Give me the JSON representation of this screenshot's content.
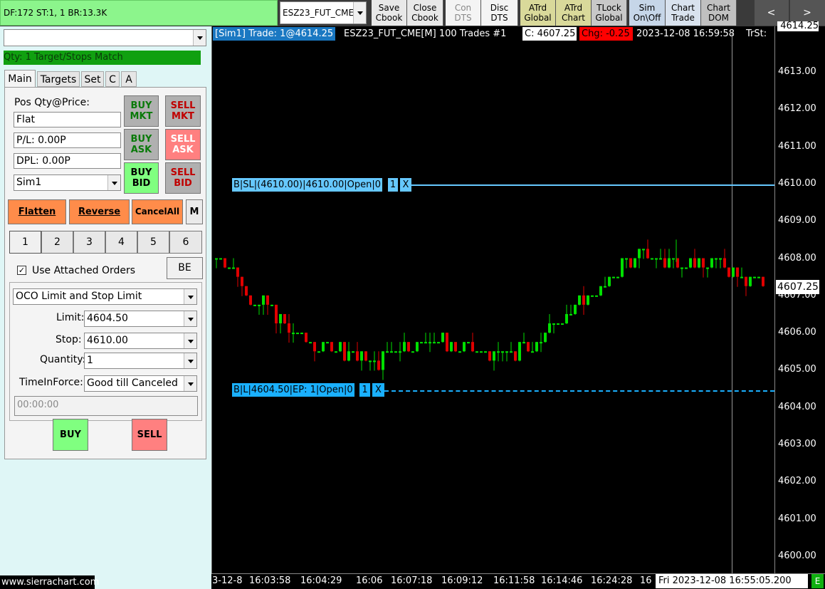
{
  "toolbar": {
    "status_text": "DF:172  ST:1, 1  BR:13.3K",
    "symbol": "ESZ23_FUT_CME",
    "buttons": [
      {
        "line1": "Save",
        "line2": "Cbook"
      },
      {
        "line1": "Close",
        "line2": "Cbook"
      },
      {
        "line1": "Con",
        "line2": "DTS"
      },
      {
        "line1": "Disc",
        "line2": "DTS"
      },
      {
        "line1": "ATrd",
        "line2": "Global"
      },
      {
        "line1": "ATrd",
        "line2": "Chart"
      },
      {
        "line1": "TLock",
        "line2": "Global"
      },
      {
        "line1": "Sim",
        "line2": "On\\Off"
      },
      {
        "line1": "Chart",
        "line2": "Trade"
      },
      {
        "line1": "Chart",
        "line2": "DOM"
      }
    ],
    "nav_prev": "<",
    "nav_next": ">"
  },
  "panel": {
    "match_status": "Qty: 1 Target/Stops Match",
    "tabs": [
      "Main",
      "Targets",
      "Set",
      "C",
      "A"
    ],
    "pos_label": "Pos Qty@Price:",
    "pos_value": "Flat",
    "pl_value": "P/L: 0.00P",
    "dpl_value": "DPL: 0.00P",
    "account": "Sim1",
    "buy_mkt": [
      "BUY",
      "MKT"
    ],
    "sell_mkt": [
      "SELL",
      "MKT"
    ],
    "buy_ask": [
      "BUY",
      "ASK"
    ],
    "sell_ask": [
      "SELL",
      "ASK"
    ],
    "buy_bid": [
      "BUY",
      "BID"
    ],
    "sell_bid": [
      "SELL",
      "BID"
    ],
    "flatten": "Flatten",
    "reverse": "Reverse",
    "cancel_all": "CancelAll",
    "m_button": "M",
    "qty_buttons": [
      "1",
      "2",
      "3",
      "4",
      "5",
      "6"
    ],
    "use_attached": "Use Attached Orders",
    "be_button": "BE",
    "order_type": "OCO Limit and Stop Limit",
    "limit_label": "Limit:",
    "limit_value": "4604.50",
    "stop_label": "Stop:",
    "stop_value": "4610.00",
    "quantity_label": "Quantity:",
    "quantity_value": "1",
    "tif_label": "TimeInForce:",
    "tif_value": "Good till Canceled",
    "time_placeholder": "00:00:00",
    "buy": "BUY",
    "sell": "SELL"
  },
  "chart": {
    "header_trade": "[Sim1]  Trade: 1@4614.25",
    "header_symbol": "ESZ23_FUT_CME[M]  100 Trades #1",
    "header_close": "C: 4607.25",
    "header_change": "Chg: -0.25",
    "header_datetime": "2023-12-08  16:59:58",
    "header_trst": "TrSt:",
    "stop_order_label": "B|SL|(4610.00)|4610.00|Open|0",
    "stop_qty": "1",
    "stop_cancel": "X",
    "limit_order_label": "B|L|4604.50|EP: 1|Open|0",
    "limit_qty": "1",
    "limit_cancel": "X",
    "last_price_tag": "4607.25",
    "top_price_partial": "4614.25",
    "price_axis": [
      "4613.00",
      "4612.00",
      "4611.00",
      "4610.00",
      "4609.00",
      "4608.00",
      "4607.00",
      "4606.00",
      "4605.00",
      "4604.00",
      "4603.00",
      "4602.00",
      "4601.00",
      "4600.00"
    ],
    "time_axis": [
      "3-12-8",
      "16:03:58",
      "16:04:29",
      "16:06",
      "16:07:18",
      "16:09:12",
      "16:11:58",
      "16:14:46",
      "16:24:28",
      "16"
    ],
    "time_cursor": "Fri 2023-12-08   16:55:05.200",
    "watermark": "www.sierrachart.com",
    "corner_badge": "E",
    "colors": {
      "up": "#00e000",
      "down": "#e00000",
      "stop_line": "#66c8ff",
      "limit_line": "#1ab0ff"
    }
  }
}
